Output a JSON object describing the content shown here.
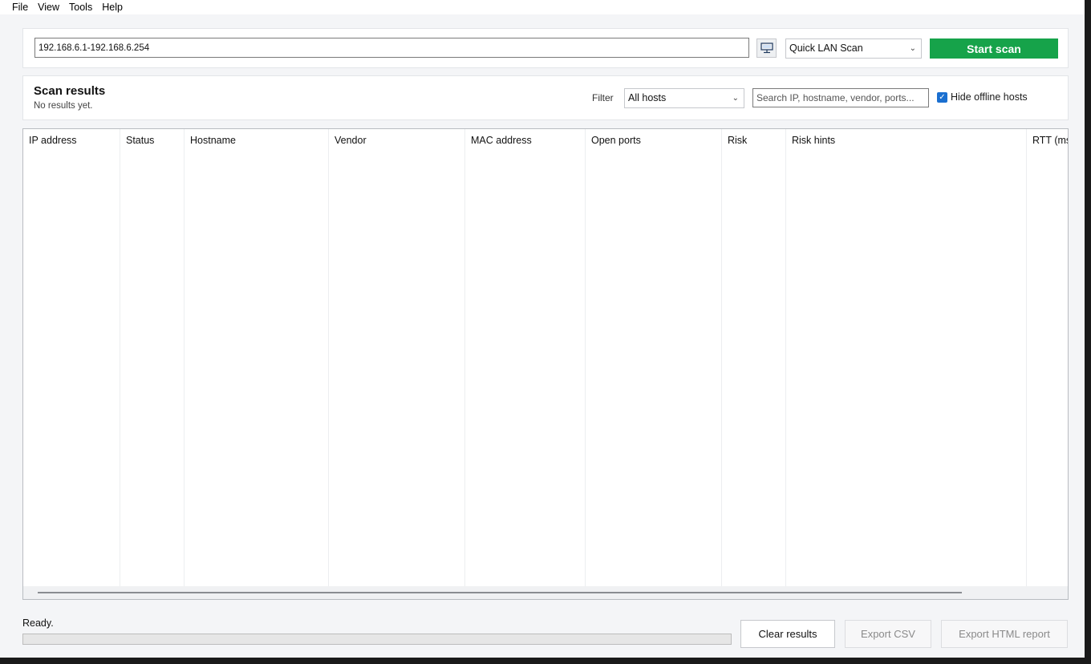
{
  "menu": {
    "items": [
      "File",
      "View",
      "Tools",
      "Help"
    ]
  },
  "scan": {
    "target_value": "192.168.6.1-192.168.6.254",
    "profile_selected": "Quick LAN Scan",
    "start_label": "Start scan"
  },
  "results": {
    "title": "Scan results",
    "subtitle": "No results yet.",
    "filter_label": "Filter",
    "filter_selected": "All hosts",
    "search_placeholder": "Search IP, hostname, vendor, ports...",
    "hide_offline_label": "Hide offline hosts",
    "hide_offline_checked": true
  },
  "table": {
    "columns": [
      "IP address",
      "Status",
      "Hostname",
      "Vendor",
      "MAC address",
      "Open ports",
      "Risk",
      "Risk hints",
      "RTT (ms)"
    ],
    "rows": []
  },
  "footer": {
    "status": "Ready.",
    "progress": 0,
    "clear_label": "Clear results",
    "csv_label": "Export CSV",
    "html_label": "Export HTML report"
  },
  "colors": {
    "accent": "#16a34a",
    "checkbox": "#1a6fd0"
  },
  "icons": {
    "nic": "network-adapter-icon",
    "dropdown": "chevron-down-icon",
    "check": "checkmark-icon"
  }
}
